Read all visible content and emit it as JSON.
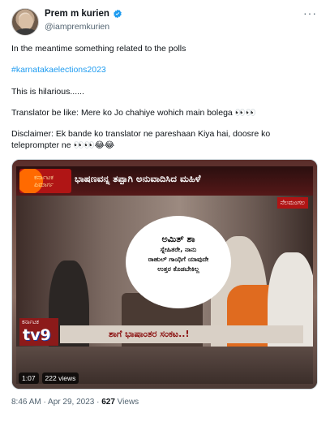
{
  "author": {
    "display_name": "Prem m kurien",
    "handle": "@iampremkurien",
    "verified_icon": "verified-badge-icon",
    "more_icon": "more-options-icon"
  },
  "body": {
    "line1": "In the meantime something related to the polls",
    "hashtag": "#karnatakaelections2023",
    "line2": "This is hilarious......",
    "line3": "Translator be like: Mere ko Jo chahiye wohich main bolega 👀👀",
    "line4a": "Disclaimer: Ek bande ko translator ne pareshaan Kiya hai, doosre ko",
    "line4b": "teleprompter ne 👀👀😂😂"
  },
  "video": {
    "headline": "ಭಾಷಣವನ್ನ ತಪ್ಪಾಗಿ ಅನುವಾದಿಸಿದ ಮಹಿಳೆ",
    "logo_text": "ಕರ್ನಾಟಕ\nಪಿಮಾರ್ಗ",
    "place": "ನೆಲಮಂಗಲ",
    "bubble_line1": "ಅಮಿತ್ ಶಾ",
    "bubble_line2": "ಸ್ನೇಹಿತರೇ, ನಾನು",
    "bubble_line3": "ರಾಹುಲ್ ಗಾಂಧಿಗೆ ಯಾವುದೇ",
    "bubble_line4": "ಉತ್ತರ ಕೊಡಬೇಕಿಲ್ಲ",
    "channel_state": "ಕರ್ನಾಟಕ",
    "channel_logo": "tv9",
    "ticker": "ಶಾಗೆ ಭಾಷಾಂತರ ಸಂಕಟ..!",
    "duration": "1:07",
    "views": "222 views"
  },
  "meta": {
    "time": "8:46 AM",
    "date": "Apr 29, 2023",
    "views_count": "627",
    "views_label": "Views"
  }
}
